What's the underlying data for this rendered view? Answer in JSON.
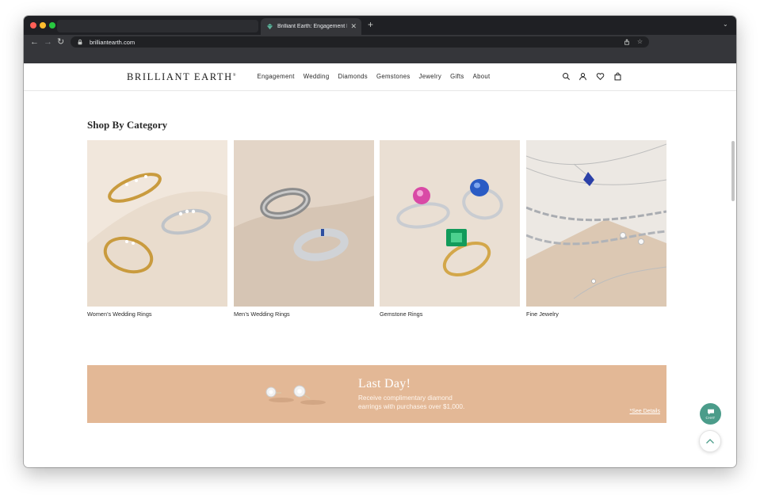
{
  "browser": {
    "active_tab_title": "Brilliant Earth: Engagement Rin",
    "url": "brilliantearth.com",
    "tab_close": "✕",
    "new_tab": "+",
    "tab_menu": "⌄"
  },
  "site": {
    "logo": "BRILLIANT EARTH",
    "logo_mark": "®",
    "nav": [
      "Engagement",
      "Wedding",
      "Diamonds",
      "Gemstones",
      "Jewelry",
      "Gifts",
      "About"
    ]
  },
  "shop_by_category": {
    "title": "Shop By Category",
    "cards": [
      {
        "label": "Women’s Wedding Rings"
      },
      {
        "label": "Men’s Wedding Rings"
      },
      {
        "label": "Gemstone Rings"
      },
      {
        "label": "Fine Jewelry"
      }
    ]
  },
  "banner": {
    "title": "Last Day!",
    "line1": "Receive complimentary diamond",
    "line2": "earrings with purchases over $1,000.",
    "link": "*See Details"
  },
  "chat": {
    "label": "CHAT"
  },
  "colors": {
    "banner_bg": "#e3b896",
    "chat_bg": "#4b9c8a",
    "chrome_dark": "#35363a"
  }
}
